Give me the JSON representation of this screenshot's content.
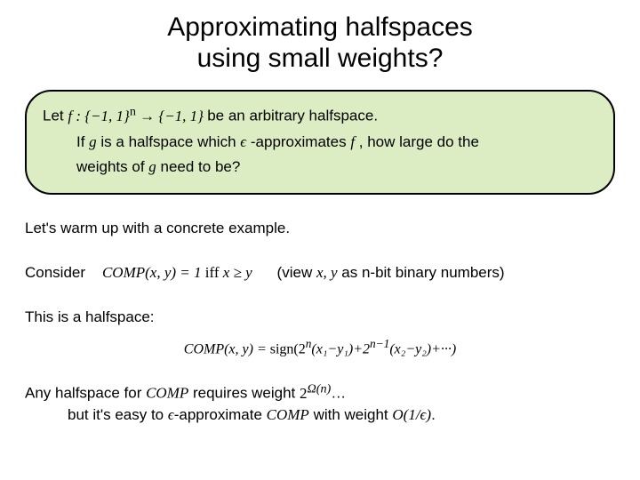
{
  "title_line1": "Approximating halfspaces",
  "title_line2": "using small weights?",
  "box": {
    "let": "Let ",
    "f_domain": "f : {−1, 1}",
    "sup_n": "n",
    "arrow": " → {−1, 1}",
    "be_halfspace": " be an arbitrary halfspace.",
    "if": "If ",
    "g": "g",
    "is_halfspace_which": " is a halfspace which ",
    "eps": "ϵ",
    "approximates": "-approximates ",
    "f": "f",
    "how_large": ", how large do the",
    "weights_of": "weights of ",
    "g2": "g",
    "need_to_be": " need to be?"
  },
  "warmup": "Let's warm up with a concrete example.",
  "consider": {
    "label": "Consider",
    "comp_def": "COMP(x, y) = 1",
    "iff": " iff ",
    "xgey": "x ≥ y",
    "view": "(view ",
    "xy": "x, y",
    "asbits": " as n-bit binary numbers)"
  },
  "this_is": "This is a halfspace:",
  "comp_eq": {
    "lhs": "COMP(x, y) = ",
    "sign": "sign(2",
    "n": "n",
    "t1": "(x₁−y₁)+2",
    "nm1": "n−1",
    "t2": "(x₂−y₂)+···)"
  },
  "closing": {
    "any_halfspace_for": "Any halfspace  for ",
    "comp": "COMP",
    "requires_weight": " requires weight ",
    "two_omega": "2",
    "omega_n": "Ω(n)",
    "dots": "…",
    "but_easy": "but it's easy to ",
    "eps": "ϵ",
    "approx": "-approximate ",
    "comp2": "COMP",
    "with_weight": " with weight ",
    "bigO": "O(1/ϵ)",
    "period": "."
  }
}
